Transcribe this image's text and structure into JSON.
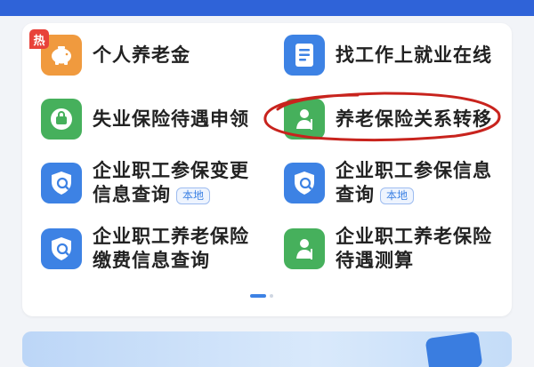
{
  "hot_badge": "热",
  "services": {
    "personal_pension": "个人养老金",
    "job_search": "找工作上就业在线",
    "unemployment_claim": "失业保险待遇申领",
    "pension_transfer": "养老保险关系转移",
    "change_query_line1": "企业职工参保变更",
    "change_query_line2": "信息查询",
    "info_query_line1": "企业职工参保信息",
    "info_query_line2": "查询",
    "local_tag": "本地",
    "payment_query_line1": "企业职工养老保险",
    "payment_query_line2": "缴费信息查询",
    "benefit_calc_line1": "企业职工养老保险",
    "benefit_calc_line2": "待遇测算"
  },
  "colors": {
    "orange": "#f09a3e",
    "blue": "#3d82e4",
    "green": "#46b05c",
    "hot_red": "#e8423a",
    "annotation_red": "#c8231d"
  }
}
